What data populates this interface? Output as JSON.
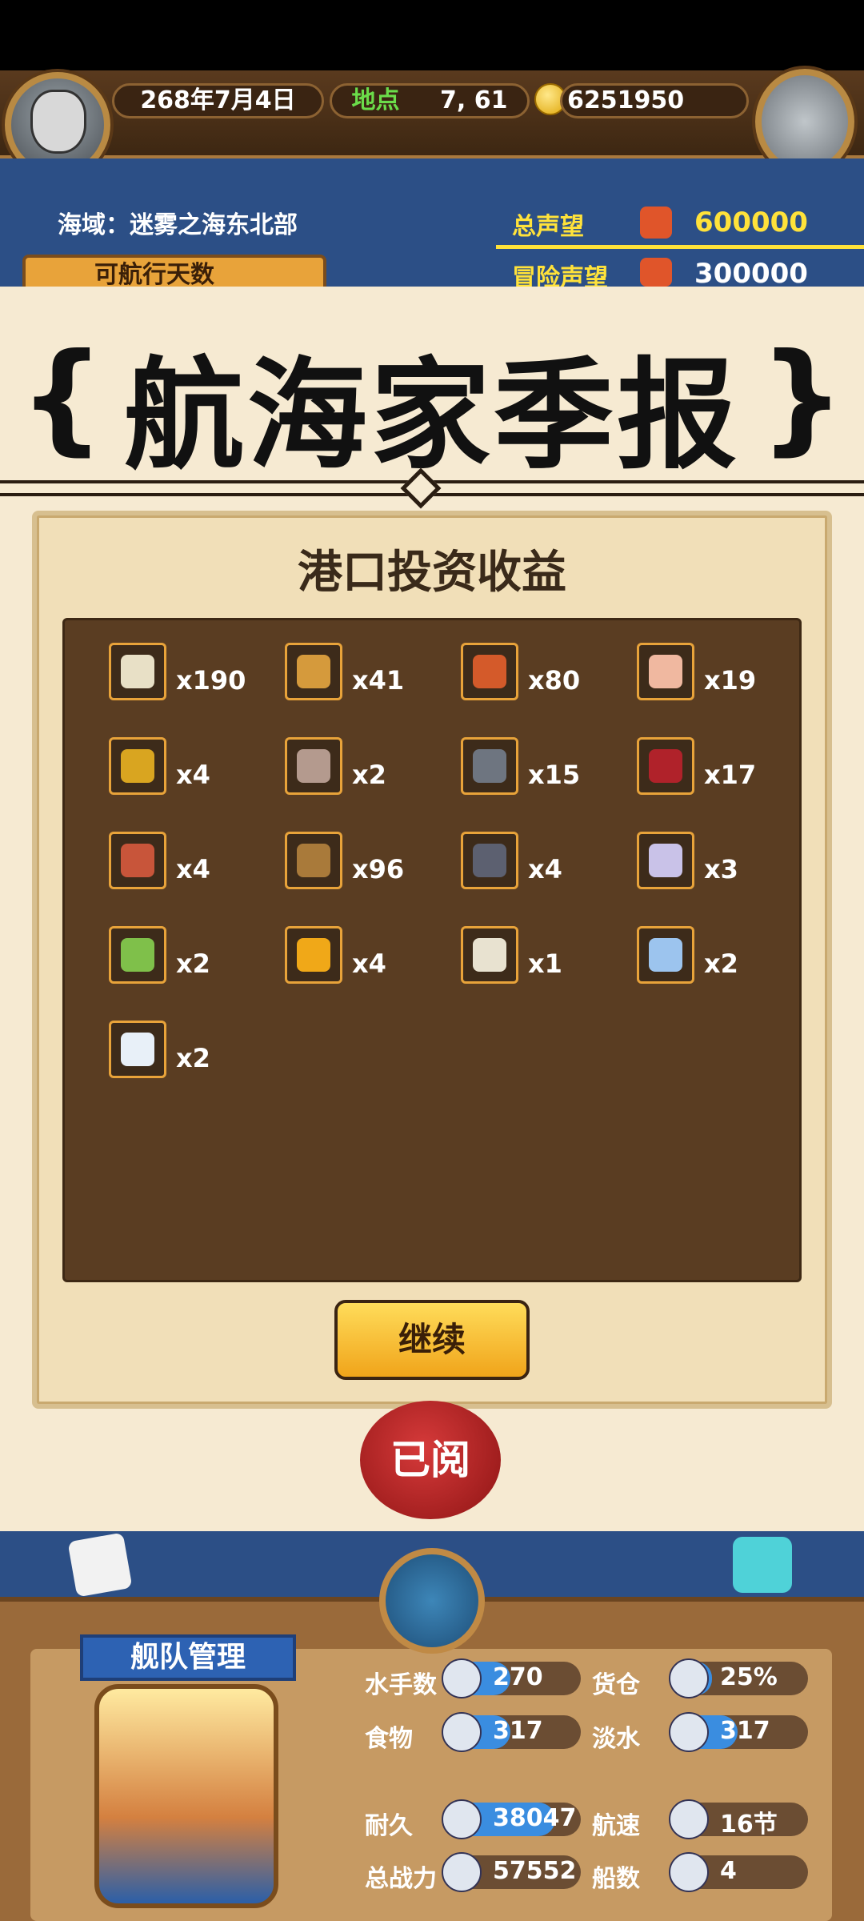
{
  "header": {
    "date": "268年7月4日",
    "location_label": "地点",
    "location_value": "7, 61",
    "gold": "6251950"
  },
  "sea_area": {
    "text": "海域：迷雾之海东北部"
  },
  "reputation": {
    "total_label": "总声望",
    "total_value": "600000",
    "adventure_label": "冒险声望",
    "adventure_value": "300000",
    "navigable_label": "可航行天数"
  },
  "banner": {
    "title": "航海家季报",
    "left_bracket": "{",
    "right_bracket": "}"
  },
  "panel": {
    "title": "港口投资收益",
    "continue_label": "继续",
    "seal_label": "已阅"
  },
  "items": [
    {
      "icon": "fish-bone-icon",
      "qty": "x190",
      "color": "#e8e0c6"
    },
    {
      "icon": "wood-plank-icon",
      "qty": "x41",
      "color": "#d59a3c"
    },
    {
      "icon": "red-lumber-icon",
      "qty": "x80",
      "color": "#d45a2a"
    },
    {
      "icon": "pink-stone-icon",
      "qty": "x19",
      "color": "#f0b8a0"
    },
    {
      "icon": "gold-bar-icon",
      "qty": "x4",
      "color": "#d9a520"
    },
    {
      "icon": "cloth-stack-icon",
      "qty": "x2",
      "color": "#b49a8e"
    },
    {
      "icon": "iron-ore-icon",
      "qty": "x15",
      "color": "#6e7580"
    },
    {
      "icon": "red-books-icon",
      "qty": "x17",
      "color": "#b0222a"
    },
    {
      "icon": "coral-icon",
      "qty": "x4",
      "color": "#c8553a"
    },
    {
      "icon": "rope-coil-icon",
      "qty": "x96",
      "color": "#a97a3a"
    },
    {
      "icon": "steel-plate-icon",
      "qty": "x4",
      "color": "#5c6070"
    },
    {
      "icon": "crystal-icon",
      "qty": "x3",
      "color": "#c9c2e8"
    },
    {
      "icon": "potion-icon",
      "qty": "x2",
      "color": "#7fc04a"
    },
    {
      "icon": "amber-gem-icon",
      "qty": "x4",
      "color": "#f0a818"
    },
    {
      "icon": "shell-icon",
      "qty": "x1",
      "color": "#e8e2d0"
    },
    {
      "icon": "ice-gem-icon",
      "qty": "x2",
      "color": "#9cc4ee"
    },
    {
      "icon": "pearl-icon",
      "qty": "x2",
      "color": "#e8f0f8"
    }
  ],
  "fleet": {
    "title": "舰队管理",
    "stats": [
      {
        "label": "水手数",
        "value": "270",
        "fill": 0.45
      },
      {
        "label": "货仓",
        "value": "25%",
        "fill": 0.25
      },
      {
        "label": "食物",
        "value": "317",
        "fill": 0.45
      },
      {
        "label": "淡水",
        "value": "317",
        "fill": 0.45
      },
      {
        "label": "耐久",
        "value": "38047",
        "fill": 0.8
      },
      {
        "label": "航速",
        "value": "16节",
        "fill": 0.0
      },
      {
        "label": "总战力",
        "value": "57552",
        "fill": 0.0
      },
      {
        "label": "船数",
        "value": "4",
        "fill": 0.0
      }
    ]
  }
}
